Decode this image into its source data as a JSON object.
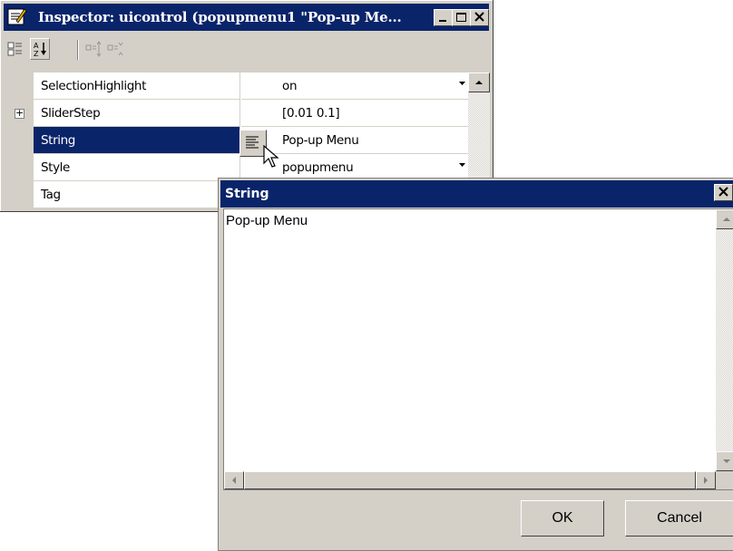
{
  "inspector": {
    "title": "Inspector:  uicontrol (popupmenu1 \"Pop-up Me...",
    "icons": [
      "inspector-app-icon",
      "categorized-icon",
      "sort-alpha-icon",
      "expand-all-icon",
      "collapse-all-icon",
      "minimize-icon",
      "maximize-icon",
      "close-icon"
    ],
    "rows": [
      {
        "name": "SelectionHighlight",
        "value": "on",
        "expander": "",
        "dropdown": true
      },
      {
        "name": "SliderStep",
        "value": "[0.01 0.1]",
        "expander": "+",
        "dropdown": false
      },
      {
        "name": "String",
        "value": "Pop-up Menu",
        "expander": "",
        "dropdown": false,
        "selected": true
      },
      {
        "name": "Style",
        "value": "popupmenu",
        "expander": "",
        "dropdown": true
      },
      {
        "name": "Tag",
        "value": "",
        "expander": "",
        "dropdown": false
      }
    ]
  },
  "dialog": {
    "title": "String",
    "text": "Pop-up Menu",
    "ok_label": "OK",
    "cancel_label": "Cancel"
  },
  "colors": {
    "title_bar": "#0a246a",
    "chrome": "#d4d0c8",
    "selection": "#0a246a"
  }
}
